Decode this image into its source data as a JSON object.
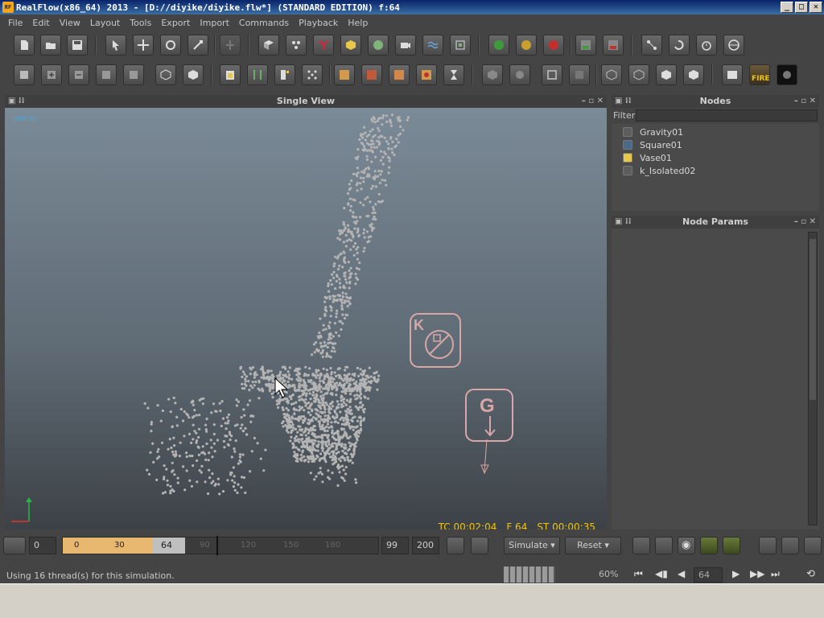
{
  "window": {
    "title": "RealFlow(x86_64) 2013 - [D://diyike/diyike.flw*] (STANDARD EDITION) f:64",
    "app_icon_text": "RF"
  },
  "menu": [
    "File",
    "Edit",
    "View",
    "Layout",
    "Tools",
    "Export",
    "Import",
    "Commands",
    "Playback",
    "Help"
  ],
  "viewport": {
    "title": "Single View",
    "camera_label": "persp",
    "hud": {
      "tc": "TC 00:02:04",
      "frame": "F 64",
      "st": "ST 00:00:35"
    },
    "gizmo_k": "K",
    "gizmo_g": "G"
  },
  "nodes_panel": {
    "title": "Nodes",
    "filter_label": "Filter",
    "filter_value": "",
    "items": [
      {
        "label": "Gravity01",
        "icon": "daemon-icon"
      },
      {
        "label": "Square01",
        "icon": "emitter-icon"
      },
      {
        "label": "Vase01",
        "icon": "object-icon"
      },
      {
        "label": "k_Isolated02",
        "icon": "daemon-icon"
      }
    ]
  },
  "params_panel": {
    "title": "Node Params"
  },
  "timeline": {
    "start": "0",
    "range_start": "0",
    "tick_30": "30",
    "current": "64",
    "ticks": [
      "90",
      "120",
      "150",
      "180"
    ],
    "end_a": "99",
    "end_b": "200",
    "simulate_label": "Simulate",
    "reset_label": "Reset"
  },
  "playback": {
    "frame": "64",
    "progress": "60%"
  },
  "status": {
    "message": "Using 16 thread(s) for this simulation."
  },
  "toolbar_fire_label": "FIRE",
  "colors": {
    "hud": "#f2c400",
    "persp": "#4aa3d9",
    "gizmo": "#d7a7a7"
  }
}
